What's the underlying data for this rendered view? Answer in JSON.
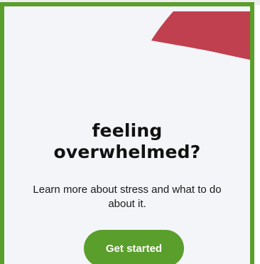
{
  "card": {
    "heading_line1": "feeling",
    "heading_line2": "overwhelmed?",
    "body": "Learn more about stress and what to do about it.",
    "cta_label": "Get started"
  },
  "colors": {
    "border": "#5a9e2c",
    "button": "#5a9e2c",
    "accent_shape": "#c0404f",
    "card_background": "#f4f5f9",
    "text": "#111111"
  }
}
